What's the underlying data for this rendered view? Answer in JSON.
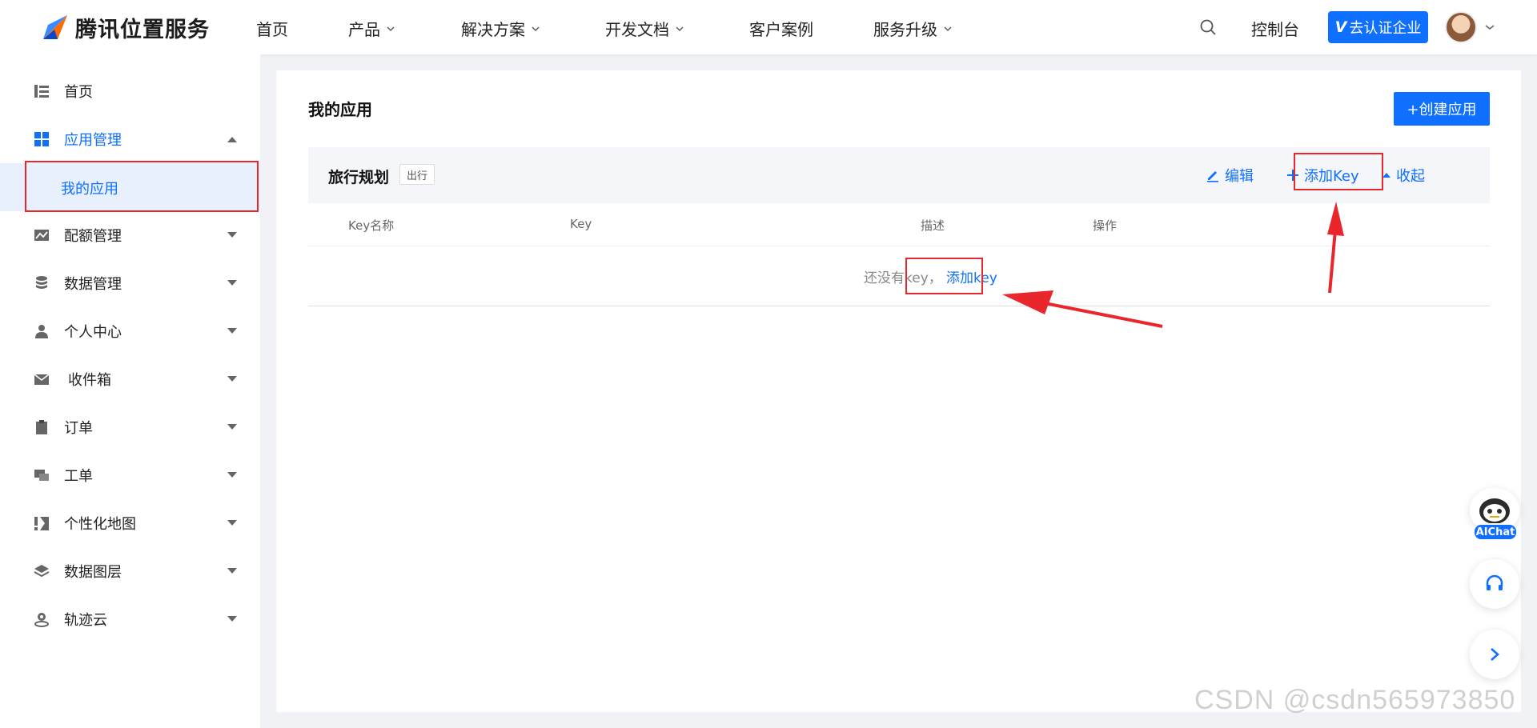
{
  "header": {
    "brand": "腾讯位置服务",
    "nav": [
      {
        "label": "首页",
        "has_menu": false
      },
      {
        "label": "产品",
        "has_menu": true
      },
      {
        "label": "解决方案",
        "has_menu": true
      },
      {
        "label": "开发文档",
        "has_menu": true
      },
      {
        "label": "客户案例",
        "has_menu": false
      },
      {
        "label": "服务升级",
        "has_menu": true
      }
    ],
    "console": "控制台",
    "verify_button": "去认证企业",
    "verify_badge": "V"
  },
  "sidebar": {
    "items": [
      {
        "label": "首页",
        "icon": "list-icon"
      },
      {
        "label": "应用管理",
        "icon": "grid-icon"
      },
      {
        "label": "配额管理",
        "icon": "chart-icon"
      },
      {
        "label": "数据管理",
        "icon": "database-icon"
      },
      {
        "label": "个人中心",
        "icon": "user-icon"
      },
      {
        "label": "收件箱",
        "icon": "mail-icon"
      },
      {
        "label": "订单",
        "icon": "clipboard-icon"
      },
      {
        "label": "工单",
        "icon": "ticket-icon"
      },
      {
        "label": "个性化地图",
        "icon": "map-style-icon"
      },
      {
        "label": "数据图层",
        "icon": "layers-icon"
      },
      {
        "label": "轨迹云",
        "icon": "track-icon"
      }
    ],
    "sub_item": "我的应用"
  },
  "main": {
    "title": "我的应用",
    "create_button": "+创建应用",
    "app": {
      "name": "旅行规划",
      "tag": "出行",
      "edit": "编辑",
      "add_key": "添加Key",
      "collapse": "收起"
    },
    "table": {
      "columns": [
        "Key名称",
        "Key",
        "描述",
        "操作"
      ],
      "empty_text": "还没有key，",
      "empty_link": "添加key"
    }
  },
  "floating": {
    "aichat": "AIChat"
  },
  "watermark": "CSDN @csdn565973850",
  "colors": {
    "primary": "#0f6fff",
    "annotation_red": "#e8262b"
  }
}
